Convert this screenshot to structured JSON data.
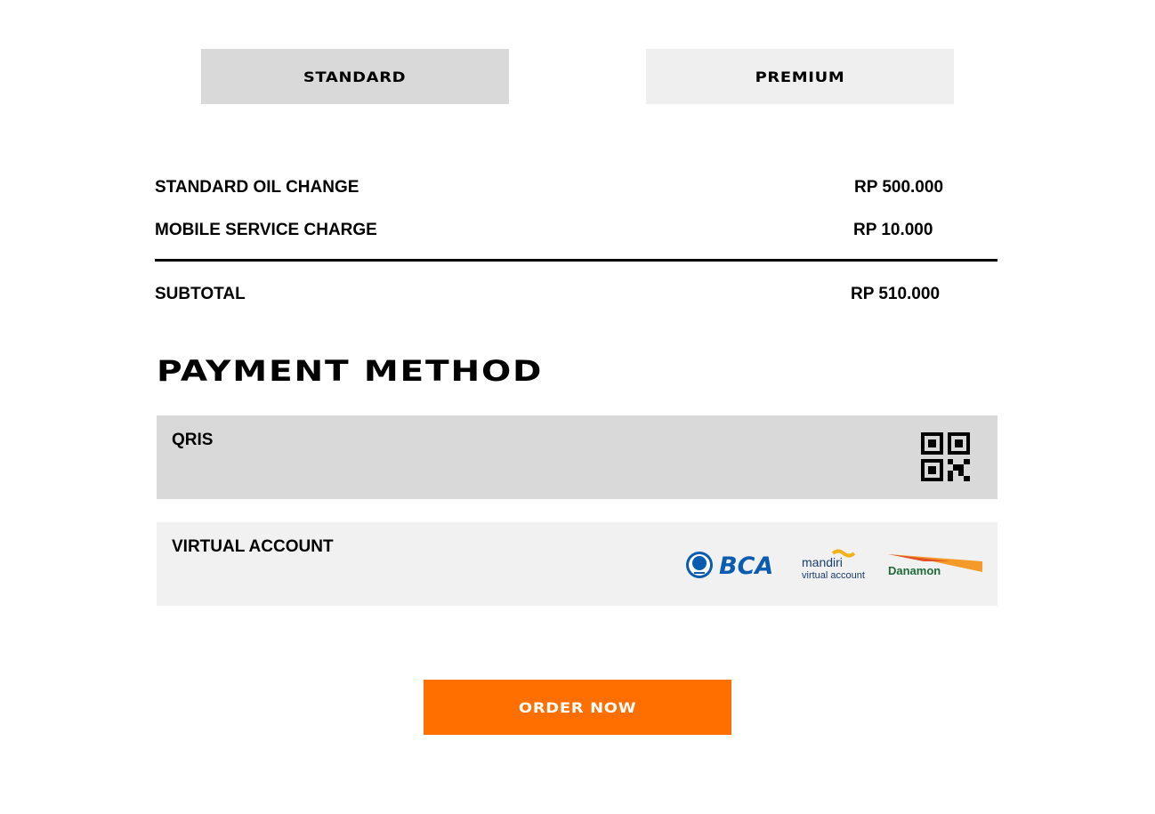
{
  "package_tabs": [
    {
      "label": "STANDARD",
      "selected": true
    },
    {
      "label": "PREMIUM",
      "selected": false
    }
  ],
  "summary": {
    "items": [
      {
        "label": "STANDARD OIL CHANGE",
        "amount": "RP 500.000"
      },
      {
        "label": "MOBILE SERVICE CHARGE",
        "amount": "RP 10.000"
      }
    ],
    "subtotal_label": "SUBTOTAL",
    "subtotal_amount": "RP 510.000"
  },
  "payment": {
    "title": "PAYMENT METHOD",
    "options": [
      {
        "label": "QRIS",
        "icon": "qr-code-icon",
        "selected": true
      },
      {
        "label": "VIRTUAL ACCOUNT",
        "selected": false,
        "banks": [
          {
            "name": "BCA",
            "logo_text": "BCA"
          },
          {
            "name": "Mandiri",
            "logo_text": "mandiri",
            "logo_subtext": "virtual account"
          },
          {
            "name": "Danamon",
            "logo_text": "Danamon"
          }
        ]
      }
    ]
  },
  "order_button": {
    "label": "ORDER NOW"
  },
  "colors": {
    "accent": "#ff6f00",
    "selected_bg": "#d9d9d9",
    "unselected_bg": "#efefef",
    "bca_blue": "#0a5cb0",
    "mandiri_navy": "#1a3b6e",
    "mandiri_gold": "#f2b21b",
    "danamon_orange": "#f39a28",
    "danamon_green": "#1f6a3a"
  }
}
